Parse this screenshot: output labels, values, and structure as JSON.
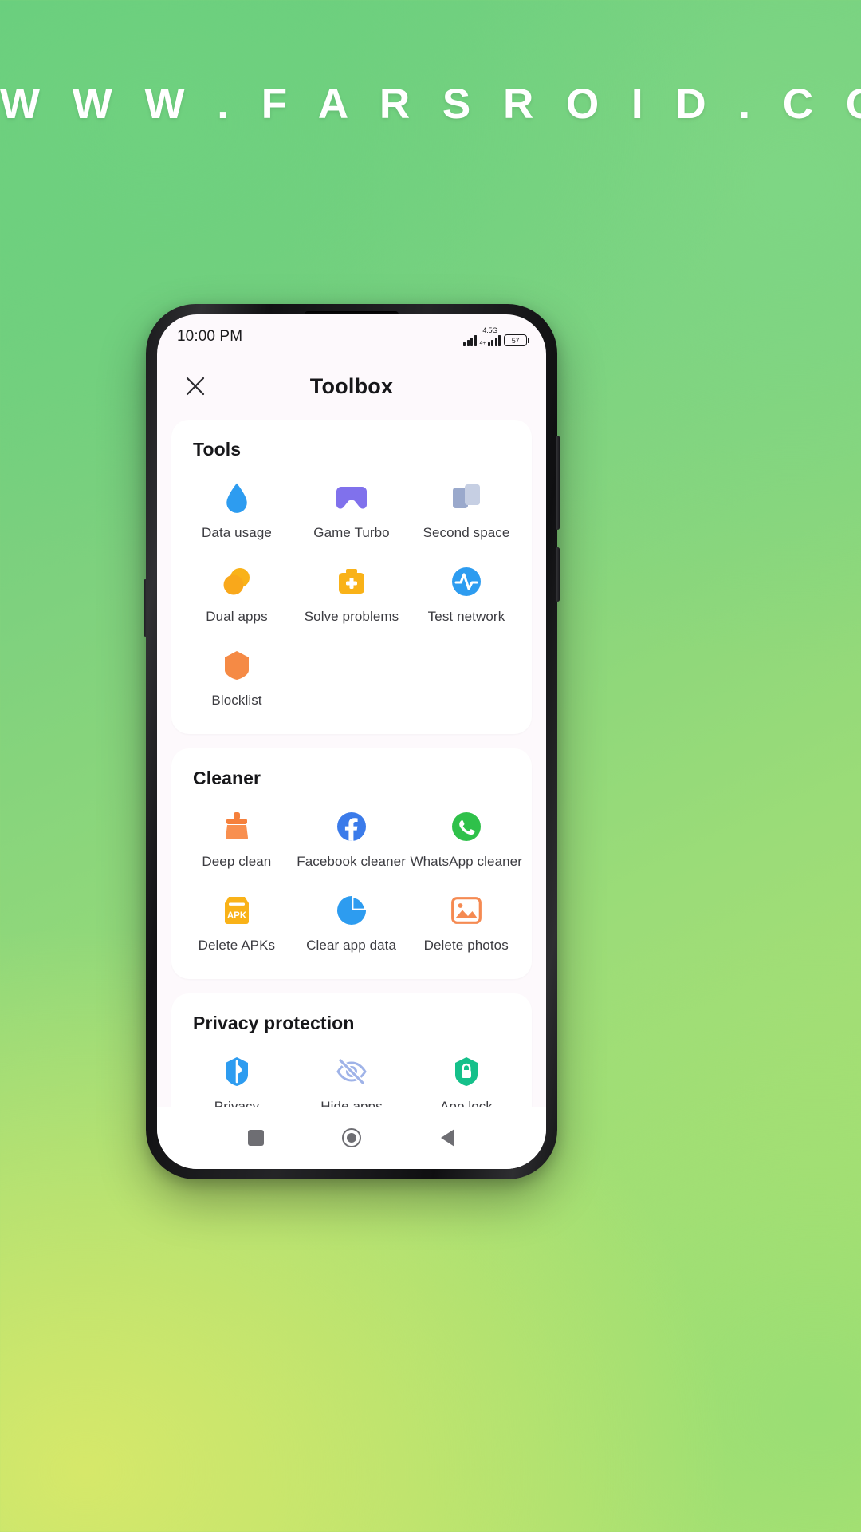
{
  "watermark": {
    "text": "W W W . F A R S R O I D . C O M"
  },
  "status_bar": {
    "time": "10:00 PM",
    "network_label": "4.5G",
    "network_sub": "4+",
    "battery_level": "57",
    "signal_icon": "signal-bars-icon",
    "battery_icon": "battery-icon"
  },
  "app_bar": {
    "close_icon": "close-icon",
    "title": "Toolbox"
  },
  "sections": [
    {
      "title": "Tools",
      "items": [
        {
          "label": "Data usage",
          "icon": "water-drop-icon",
          "color": "#2d9cf0"
        },
        {
          "label": "Game Turbo",
          "icon": "gamepad-icon",
          "color": "#8071ec"
        },
        {
          "label": "Second space",
          "icon": "two-squares-icon",
          "color": "#8e9fc6"
        },
        {
          "label": "Dual apps",
          "icon": "dual-circles-icon",
          "color": "#f9ad18"
        },
        {
          "label": "Solve problems",
          "icon": "medical-kit-icon",
          "color": "#f9b218"
        },
        {
          "label": "Test network",
          "icon": "pulse-wave-icon",
          "color": "#2d9cf0"
        },
        {
          "label": "Blocklist",
          "icon": "hexagon-shield-icon",
          "color": "#f58a45"
        }
      ]
    },
    {
      "title": "Cleaner",
      "items": [
        {
          "label": "Deep clean",
          "icon": "broom-icon",
          "color": "#f5803c"
        },
        {
          "label": "Facebook cleaner",
          "icon": "facebook-icon",
          "color": "#3b7bea"
        },
        {
          "label": "WhatsApp cleaner",
          "icon": "whatsapp-icon",
          "color": "#2fc14a"
        },
        {
          "label": "Delete APKs",
          "icon": "apk-box-icon",
          "color": "#f9b218"
        },
        {
          "label": "Clear app data",
          "icon": "pie-chart-icon",
          "color": "#2d9cf0"
        },
        {
          "label": "Delete photos",
          "icon": "photo-icon",
          "color": "#f58a52"
        }
      ]
    },
    {
      "title": "Privacy protection",
      "items": [
        {
          "label": "Privacy",
          "icon": "privacy-shield-icon",
          "color": "#2d9cf0"
        },
        {
          "label": "Hide apps",
          "icon": "eye-slash-icon",
          "color": "#9fb3e8"
        },
        {
          "label": "App lock",
          "icon": "lock-shield-icon",
          "color": "#15c08a"
        }
      ]
    }
  ],
  "nav_bar": {
    "recents_icon": "square-recents-icon",
    "home_icon": "circle-home-icon",
    "back_icon": "triangle-back-icon"
  }
}
